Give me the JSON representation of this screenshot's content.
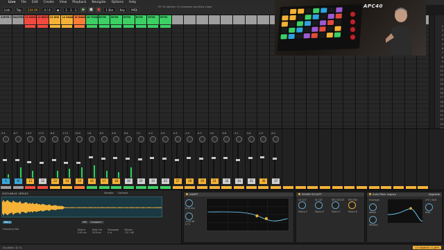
{
  "menubar": {
    "app": "Live",
    "items": [
      "File",
      "Edit",
      "Create",
      "View",
      "Playback",
      "Navigate",
      "Options",
      "Help"
    ]
  },
  "transport": {
    "link": "Link",
    "tap": "Tap",
    "tempo": "124.00",
    "meter": "4 / 4",
    "quantize": "1 Bar",
    "position": "1 . 1 . 1",
    "key": "Key",
    "midi": "MIDI",
    "document_title": "RP 34 Ableton 12 hardware workflow video"
  },
  "tracks": [
    {
      "name": "SUPER CH",
      "color": "#9e9e9e"
    },
    {
      "name": "MASTER",
      "color": "#9e9e9e"
    },
    {
      "name": "11 KICKS",
      "color": "#f24a3f"
    },
    {
      "name": "12 RECORD TRA",
      "color": "#f24a3f"
    },
    {
      "name": "13 HHS",
      "color": "#f5b237"
    },
    {
      "name": "14 SHAKERS R",
      "color": "#f5b237"
    },
    {
      "name": "15 SNARES CLA",
      "color": "#ff7d35"
    },
    {
      "name": "16 TOMS",
      "color": "#3cd065"
    },
    {
      "name": "RYTM",
      "color": "#3cd065"
    },
    {
      "name": "RYTM",
      "color": "#3cd065"
    },
    {
      "name": "RYTM",
      "color": "#3cd065"
    },
    {
      "name": "RYTM",
      "color": "#3cd065"
    },
    {
      "name": "RYTM",
      "color": "#3cd065"
    },
    {
      "name": "RYTM",
      "color": "#3cd065"
    }
  ],
  "mixer": {
    "strips": [
      {
        "vol": "-9.4",
        "num": "S",
        "numColor": "#3aa6d9",
        "meter": 0.1,
        "fader": 0.55
      },
      {
        "vol": "-8.7",
        "num": "M",
        "numColor": "#3aa6d9",
        "meter": 0.3,
        "fader": 0.55
      },
      {
        "vol": "-14.9",
        "num": "11",
        "numColor": "#f5b237",
        "meter": 0.2,
        "fader": 0.5
      },
      {
        "vol": "-17.0",
        "num": "12",
        "numColor": "#cfcfcf",
        "meter": 0.0,
        "fader": 0.48
      },
      {
        "vol": "-8.8",
        "num": "13",
        "numColor": "#f5b237",
        "meter": 0.2,
        "fader": 0.55
      },
      {
        "vol": "-17.0",
        "num": "14",
        "numColor": "#f5b237",
        "meter": 0.25,
        "fader": 0.48
      },
      {
        "vol": "-16.9",
        "num": "15",
        "numColor": "#f5b237",
        "meter": 0.3,
        "fader": 0.48
      },
      {
        "vol": "-1.8",
        "num": "16",
        "numColor": "#f5b237",
        "meter": 0.35,
        "fader": 0.62
      },
      {
        "vol": "-6.5",
        "num": "17",
        "numColor": "#f5b237",
        "meter": 0.2,
        "fader": 0.58
      },
      {
        "vol": "-4.8",
        "num": "18",
        "numColor": "#f5b237",
        "meter": 0.15,
        "fader": 0.6
      },
      {
        "vol": "-6.8",
        "num": "19",
        "numColor": "#cfcfcf",
        "meter": 0.3,
        "fader": 0.58
      },
      {
        "vol": "-7.2",
        "num": "20",
        "numColor": "#cfcfcf",
        "meter": 0.0,
        "fader": 0.57
      },
      {
        "vol": "-4.0",
        "num": "21",
        "numColor": "#cfcfcf",
        "meter": 0.0,
        "fader": 0.6
      },
      {
        "vol": "-5.6",
        "num": "22",
        "numColor": "#cfcfcf",
        "meter": 0.0,
        "fader": 0.58
      },
      {
        "vol": "-9.4",
        "num": "27",
        "numColor": "#f5b237",
        "meter": 0.0,
        "fader": 0.55
      },
      {
        "vol": "-4.4",
        "num": "28",
        "numColor": "#f5b237",
        "meter": 0.0,
        "fader": 0.6
      },
      {
        "vol": "-6.3",
        "num": "29",
        "numColor": "#f5b237",
        "meter": 0.0,
        "fader": 0.58
      },
      {
        "vol": "-4.0",
        "num": "31",
        "numColor": "#f5b237",
        "meter": 0.0,
        "fader": 0.6
      },
      {
        "vol": "-4.8",
        "num": "32",
        "numColor": "#cfcfcf",
        "meter": 0.0,
        "fader": 0.6
      },
      {
        "vol": "-9.1",
        "num": "34",
        "numColor": "#cfcfcf",
        "meter": 0.0,
        "fader": 0.55
      },
      {
        "vol": "-3.8",
        "num": "35",
        "numColor": "#cfcfcf",
        "meter": 0.0,
        "fader": 0.6
      },
      {
        "vol": "-1.9",
        "num": "36",
        "numColor": "#f5b237",
        "meter": 0.0,
        "fader": 0.62
      },
      {
        "vol": "-6.0",
        "num": "37",
        "numColor": "#cfcfcf",
        "meter": 0.0,
        "fader": 0.58
      }
    ]
  },
  "clip_view": {
    "title": "2023-08-01 163102",
    "tabs": [
      "Sample",
      "Controls"
    ],
    "warp": "Warp",
    "fade_in": "Fade In",
    "fade_in_value": "0.00 ms",
    "fade_out": "Fade Out",
    "fade_out_value": "29.8 ms",
    "transpose": "Transpose",
    "transpose_value": "0 st",
    "volume": "Volume",
    "volume_value": "-13.7 dB",
    "hifi": "HiFi",
    "complex": "Complex+",
    "frequency": "Frequency",
    "res": "Res"
  },
  "devices": {
    "eq_title": "ADAPT",
    "eq_freq": "6.33 kHz",
    "eq_gain": "-3.42 dB",
    "eq_q": "0.71",
    "bus_title": "SHARE SCULPT",
    "bus_labels": [
      "LO CUT",
      "HI CUT",
      "REV DECAY",
      "REV MIX"
    ],
    "bus_values": [
      "Macro 5",
      "Macro 6",
      "Macro 7",
      "Macro 8"
    ],
    "filter_title": "Auto Filter Legacy",
    "filter_env": "Envelope",
    "filter_attack": "Attack",
    "filter_release": "Release",
    "filter_lfo": "LFO / S&H",
    "filter_rate": "Rate",
    "filter_upgrade": "Upgrade"
  },
  "scene_numbers": [
    "1",
    "2",
    "3",
    "4",
    "5",
    "6",
    "7",
    "8",
    "9",
    "10",
    "11",
    "12",
    "13",
    "14",
    "15",
    "16",
    "17",
    "18",
    "19",
    "20",
    "21",
    "22",
    "23",
    "24",
    "25"
  ],
  "status": {
    "left": "Dry/Wet: 42 %",
    "selected": "13 SNARES CLAPS"
  },
  "colors": {
    "accent": "#f5b237",
    "meter": "#2bd35d",
    "wave": "#f5b237",
    "blue": "#3aa6d9"
  }
}
